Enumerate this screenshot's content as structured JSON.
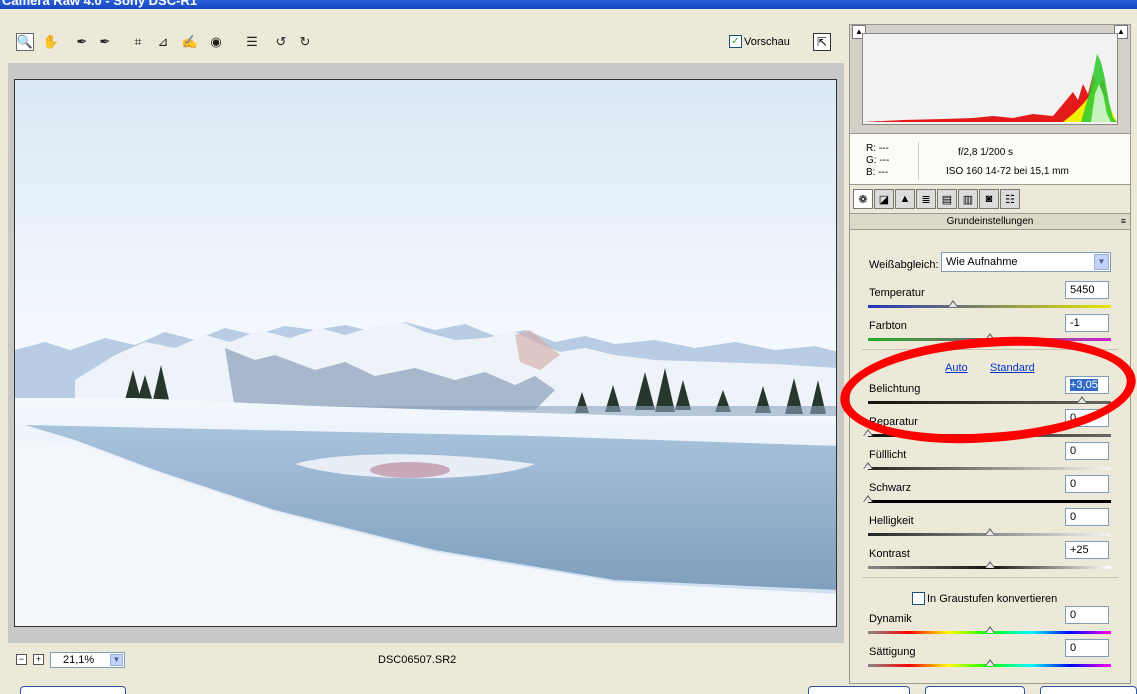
{
  "window": {
    "title": "Camera Raw 4.0 - Sony DSC-R1"
  },
  "toolbar": {
    "tools": [
      {
        "name": "zoom-tool",
        "icon": "magnifier-icon",
        "glyph": "🔍"
      },
      {
        "name": "hand-tool",
        "icon": "hand-icon",
        "glyph": "✋"
      },
      {
        "name": "white-balance-tool",
        "icon": "eyedropper-icon",
        "glyph": "✒"
      },
      {
        "name": "color-sampler-tool",
        "icon": "color-sampler-icon",
        "glyph": "✒"
      },
      {
        "name": "crop-tool",
        "icon": "crop-icon",
        "glyph": "⌗"
      },
      {
        "name": "straighten-tool",
        "icon": "straighten-icon",
        "glyph": "⊿"
      },
      {
        "name": "retouch-tool",
        "icon": "brush-icon",
        "glyph": "✍"
      },
      {
        "name": "red-eye-tool",
        "icon": "red-eye-icon",
        "glyph": "◉"
      },
      {
        "name": "preferences-tool",
        "icon": "list-icon",
        "glyph": "☰"
      },
      {
        "name": "rotate-left-tool",
        "icon": "rotate-left-icon",
        "glyph": "↺"
      },
      {
        "name": "rotate-right-tool",
        "icon": "rotate-right-icon",
        "glyph": "↻"
      }
    ],
    "preview_label": "Vorschau",
    "preview_checked": true
  },
  "status": {
    "zoom_value": "21,1%",
    "filename": "DSC06507.SR2"
  },
  "info": {
    "r": "R:  ---",
    "g": "G:  ---",
    "b": "B:  ---",
    "aperture_shutter": "f/2,8    1/200 s",
    "iso_lens": "ISO 160    14-72 bei 15,1 mm"
  },
  "panel": {
    "tabs": [
      {
        "name": "tab-basic",
        "icon": "aperture-icon",
        "glyph": "❁",
        "active": true
      },
      {
        "name": "tab-tone-curve",
        "icon": "tone-curve-icon",
        "glyph": "◪"
      },
      {
        "name": "tab-detail",
        "icon": "detail-icon",
        "glyph": "▲"
      },
      {
        "name": "tab-hsl",
        "icon": "hsl-icon",
        "glyph": "≣"
      },
      {
        "name": "tab-split-toning",
        "icon": "split-toning-icon",
        "glyph": "▤"
      },
      {
        "name": "tab-lens",
        "icon": "lens-icon",
        "glyph": "▥"
      },
      {
        "name": "tab-camera-calibration",
        "icon": "camera-icon",
        "glyph": "◙"
      },
      {
        "name": "tab-presets",
        "icon": "presets-icon",
        "glyph": "☷"
      }
    ],
    "section_title": "Grundeinstellungen",
    "white_balance_label": "Weißabgleich:",
    "white_balance_value": "Wie Aufnahme",
    "auto_link": "Auto",
    "standard_link": "Standard",
    "grayscale_label": "In Graustufen konvertieren",
    "grayscale_checked": false,
    "sliders": [
      {
        "id": "temperatur",
        "label": "Temperatur",
        "value": "5450",
        "position": 0.35,
        "gradient": "blue-yellow"
      },
      {
        "id": "farbton",
        "label": "Farbton",
        "value": "-1",
        "position": 0.5,
        "gradient": "green-magenta"
      },
      {
        "id": "belichtung",
        "label": "Belichtung",
        "value": "+3,05",
        "position": 0.88,
        "gradient": "dark",
        "selected": true
      },
      {
        "id": "reparatur",
        "label": "Reparatur",
        "value": "0",
        "position": 0.0,
        "gradient": "dark"
      },
      {
        "id": "fuelllicht",
        "label": "Fülllicht",
        "value": "0",
        "position": 0.0,
        "gradient": "dark-light"
      },
      {
        "id": "schwarz",
        "label": "Schwarz",
        "value": "0",
        "position": 0.0,
        "gradient": "black"
      },
      {
        "id": "helligkeit",
        "label": "Helligkeit",
        "value": "0",
        "position": 0.5,
        "gradient": "dark-light"
      },
      {
        "id": "kontrast",
        "label": "Kontrast",
        "value": "+25",
        "position": 0.5,
        "gradient": "contrast"
      },
      {
        "id": "dynamik",
        "label": "Dynamik",
        "value": "0",
        "position": 0.5,
        "gradient": "rainbow"
      },
      {
        "id": "saettigung",
        "label": "Sättigung",
        "value": "0",
        "position": 0.5,
        "gradient": "rainbow"
      }
    ]
  },
  "colors": {
    "annotation": "#ff0000",
    "link": "#0033cc",
    "selection": "#316ac5"
  }
}
